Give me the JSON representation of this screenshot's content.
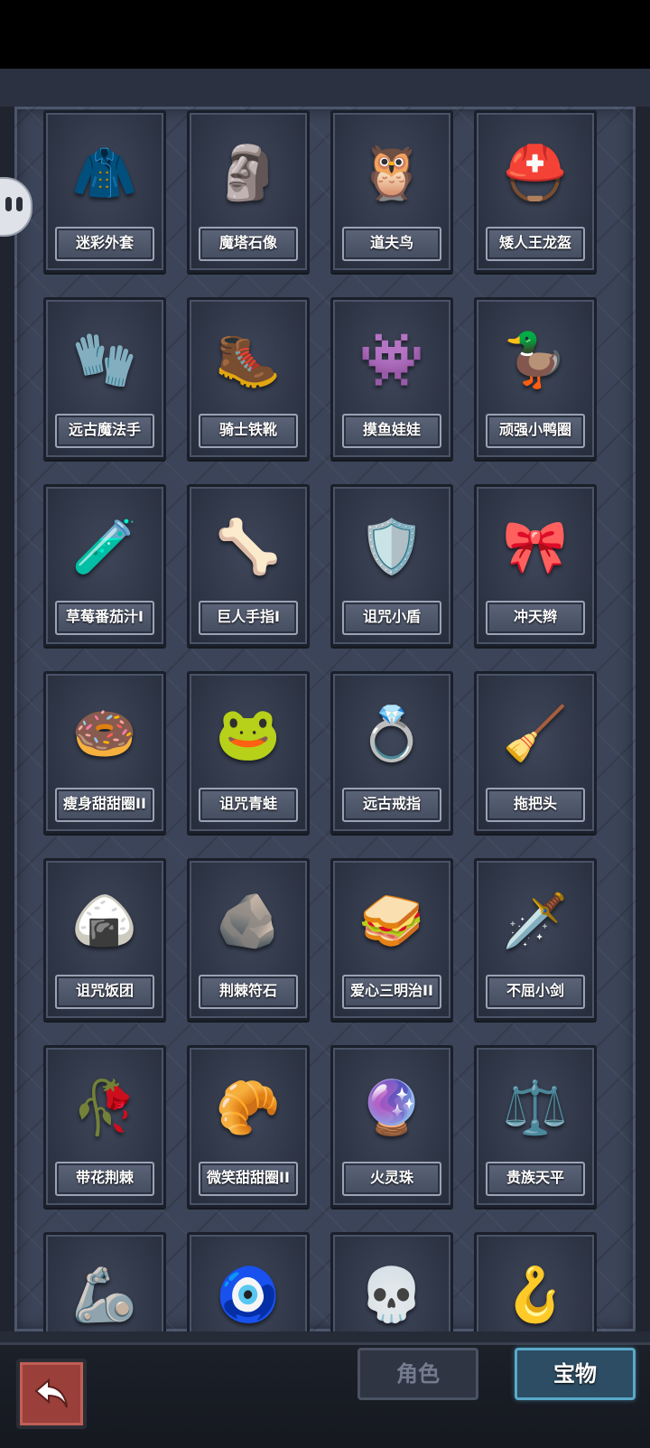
{
  "items": [
    {
      "name": "迷彩外套",
      "icon": "jacket-icon",
      "glyph": "🧥"
    },
    {
      "name": "魔塔石像",
      "icon": "stone-statue-icon",
      "glyph": "🗿"
    },
    {
      "name": "道夫鸟",
      "icon": "owl-icon",
      "glyph": "🦉"
    },
    {
      "name": "矮人王龙盔",
      "icon": "helmet-icon",
      "glyph": "⛑️"
    },
    {
      "name": "远古魔法手",
      "icon": "magic-hand-icon",
      "glyph": "🧤"
    },
    {
      "name": "骑士铁靴",
      "icon": "iron-boots-icon",
      "glyph": "🥾"
    },
    {
      "name": "摸鱼娃娃",
      "icon": "doll-icon",
      "glyph": "👾"
    },
    {
      "name": "顽强小鸭圈",
      "icon": "duck-ring-icon",
      "glyph": "🦆"
    },
    {
      "name": "草莓番茄汁I",
      "icon": "potion-icon",
      "glyph": "🧪"
    },
    {
      "name": "巨人手指I",
      "icon": "giant-finger-icon",
      "glyph": "🦴"
    },
    {
      "name": "诅咒小盾",
      "icon": "cursed-shield-icon",
      "glyph": "🛡️"
    },
    {
      "name": "冲天辫",
      "icon": "pigtail-icon",
      "glyph": "🎀"
    },
    {
      "name": "瘦身甜甜圈II",
      "icon": "donut-icon",
      "glyph": "🍩"
    },
    {
      "name": "诅咒青蛙",
      "icon": "frog-icon",
      "glyph": "🐸"
    },
    {
      "name": "远古戒指",
      "icon": "ring-icon",
      "glyph": "💍"
    },
    {
      "name": "拖把头",
      "icon": "mop-icon",
      "glyph": "🧹"
    },
    {
      "name": "诅咒饭团",
      "icon": "rice-ball-icon",
      "glyph": "🍙"
    },
    {
      "name": "荆棘符石",
      "icon": "rune-stone-icon",
      "glyph": "🪨"
    },
    {
      "name": "爱心三明治II",
      "icon": "sandwich-icon",
      "glyph": "🥪"
    },
    {
      "name": "不屈小剑",
      "icon": "sword-icon",
      "glyph": "🗡️"
    },
    {
      "name": "带花荆棘",
      "icon": "flower-thorn-icon",
      "glyph": "🥀"
    },
    {
      "name": "微笑甜甜圈II",
      "icon": "smile-donut-icon",
      "glyph": "🥐"
    },
    {
      "name": "火灵珠",
      "icon": "fire-orb-icon",
      "glyph": "🔮"
    },
    {
      "name": "贵族天平",
      "icon": "scales-icon",
      "glyph": "⚖️"
    },
    {
      "name": "",
      "icon": "armor-icon",
      "glyph": "🦾"
    },
    {
      "name": "",
      "icon": "amulet-icon",
      "glyph": "🧿"
    },
    {
      "name": "",
      "icon": "skull-jar-icon",
      "glyph": "💀"
    },
    {
      "name": "",
      "icon": "claw-icon",
      "glyph": "🪝"
    }
  ],
  "bottom": {
    "back_icon": "return-arrow-icon",
    "tabs": [
      {
        "label": "角色",
        "active": false
      },
      {
        "label": "宝物",
        "active": true
      }
    ]
  },
  "colors": {
    "panel_bg": "#3b4458",
    "card_bg": "#2d3444",
    "label_border": "#9aa3b5",
    "back_button": "#9b3f3a",
    "active_tab_border": "#5aa9c9"
  }
}
